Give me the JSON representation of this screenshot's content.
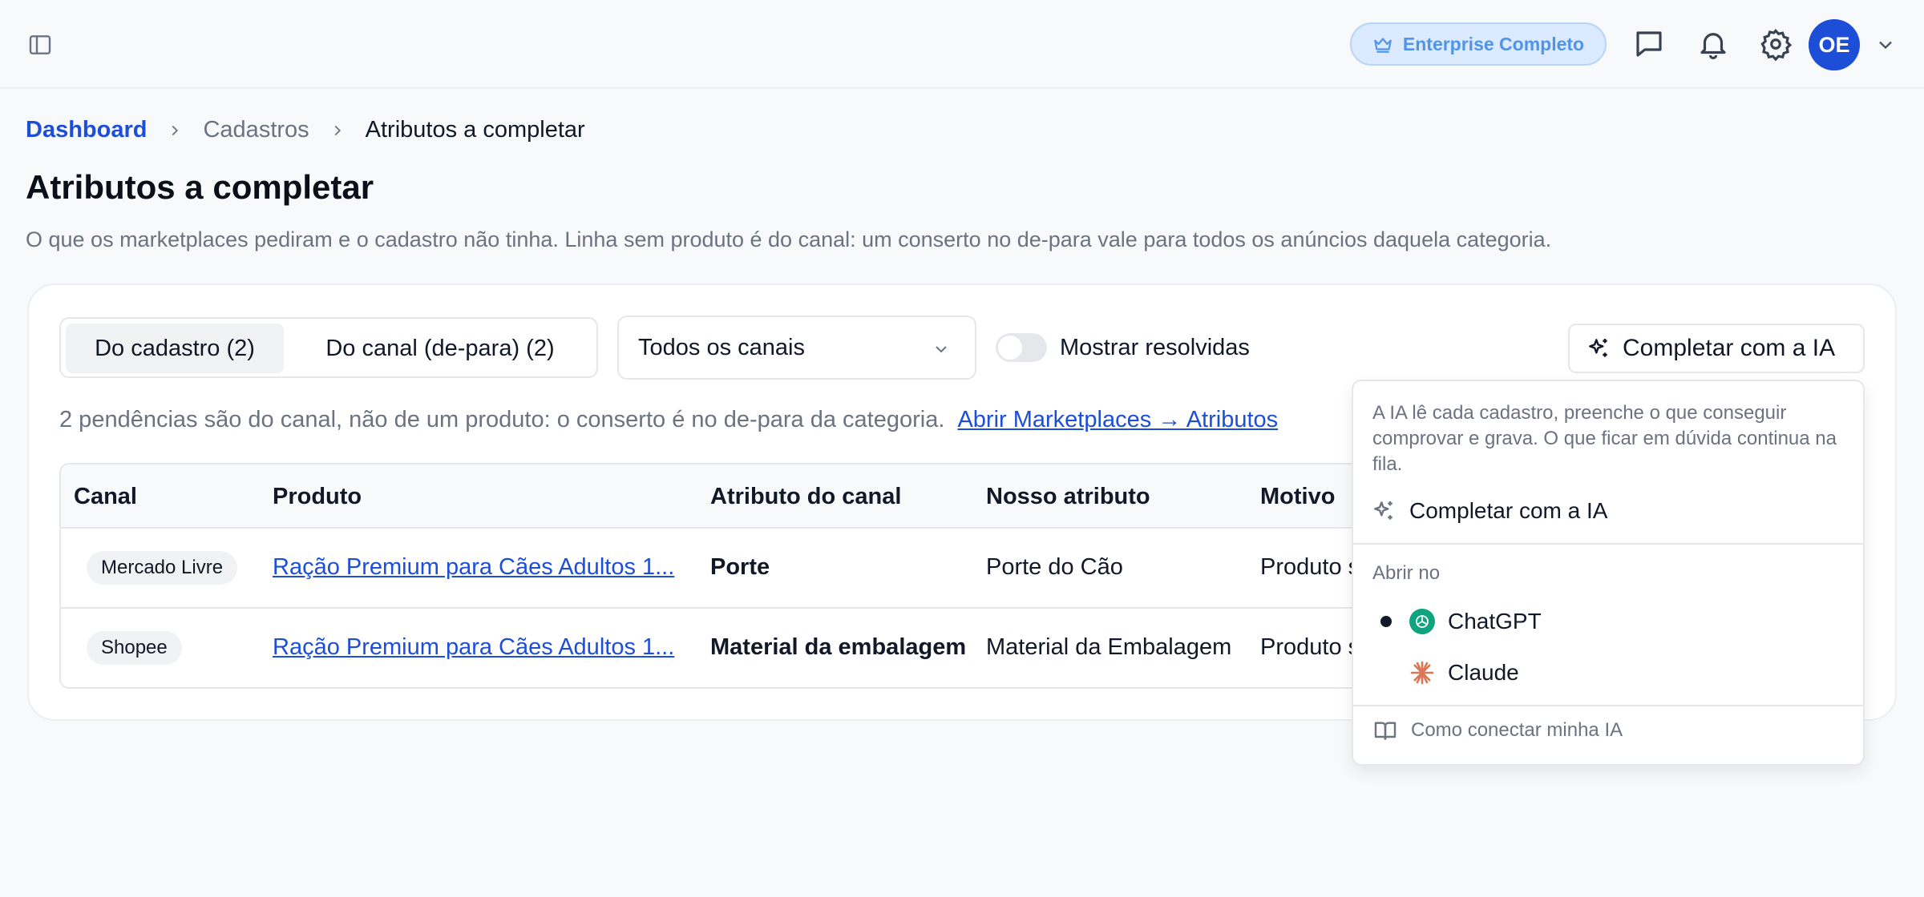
{
  "header": {
    "plan_badge": "Enterprise Completo",
    "avatar_initials": "OE",
    "icons": [
      "sidebar-toggle-icon",
      "crown-icon",
      "chat-icon",
      "bell-icon",
      "gear-icon",
      "chevron-down-icon"
    ]
  },
  "breadcrumb": {
    "items": [
      "Dashboard",
      "Cadastros",
      "Atributos a completar"
    ]
  },
  "page": {
    "title": "Atributos a completar",
    "subtitle": "O que os marketplaces pediram e o cadastro não tinha. Linha sem produto é do canal: um conserto no de-para vale para todos os anúncios daquela categoria."
  },
  "filters": {
    "tabs": [
      {
        "label": "Do cadastro (2)",
        "active": true
      },
      {
        "label": "Do canal (de-para) (2)",
        "active": false
      }
    ],
    "channel_select": "Todos os canais",
    "show_resolved_label": "Mostrar resolvidas",
    "show_resolved": false,
    "ai_button": "Completar com a IA"
  },
  "notice": {
    "text": "2 pendências são do canal, não de um produto: o conserto é no de-para da categoria.",
    "link": "Abrir Marketplaces → Atributos"
  },
  "table": {
    "columns": [
      "Canal",
      "Produto",
      "Atributo do canal",
      "Nosso atributo",
      "Motivo"
    ],
    "rows": [
      {
        "canal": "Mercado Livre",
        "produto": "Ração Premium para Cães Adultos 1...",
        "atributo_canal": "Porte",
        "nosso_atributo": "Porte do Cão",
        "motivo": "Produto s"
      },
      {
        "canal": "Shopee",
        "produto": "Ração Premium para Cães Adultos 1...",
        "atributo_canal": "Material da embalagem",
        "nosso_atributo": "Material da Embalagem",
        "motivo": "Produto s"
      }
    ]
  },
  "ai_menu": {
    "description": "A IA lê cada cadastro, preenche o que conseguir comprovar e grava. O que ficar em dúvida continua na fila.",
    "complete_action": "Completar com a IA",
    "open_in_label": "Abrir no",
    "providers": [
      {
        "name": "ChatGPT",
        "selected": true,
        "color": "#10a37f"
      },
      {
        "name": "Claude",
        "selected": false,
        "color": "#d97757"
      }
    ],
    "footer_link": "Como conectar minha IA"
  },
  "colors": {
    "accent": "#1d4ed8",
    "plan_badge_bg": "#dbeafe",
    "plan_badge_text": "#4f94e8"
  }
}
